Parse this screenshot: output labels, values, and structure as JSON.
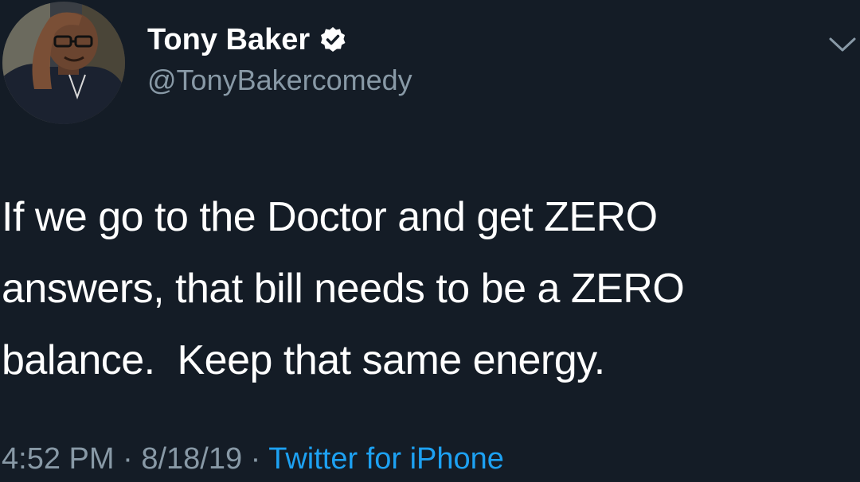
{
  "author": {
    "display_name": "Tony Baker",
    "handle": "@TonyBakercomedy",
    "verified": true,
    "avatar_icon": "profile-photo"
  },
  "tweet": {
    "text": "If we go to the Doctor and get ZERO\nanswers, that bill needs to be a ZERO\nbalance.  Keep that same energy."
  },
  "meta": {
    "time": "4:52 PM",
    "separator": "·",
    "date": "8/18/19",
    "source": "Twitter for iPhone"
  },
  "colors": {
    "background": "#141c26",
    "primary_text": "#ffffff",
    "secondary_text": "#8899a6",
    "link": "#1da1f2"
  },
  "icons": {
    "verified": "verified-badge-icon",
    "menu": "chevron-down-icon"
  }
}
